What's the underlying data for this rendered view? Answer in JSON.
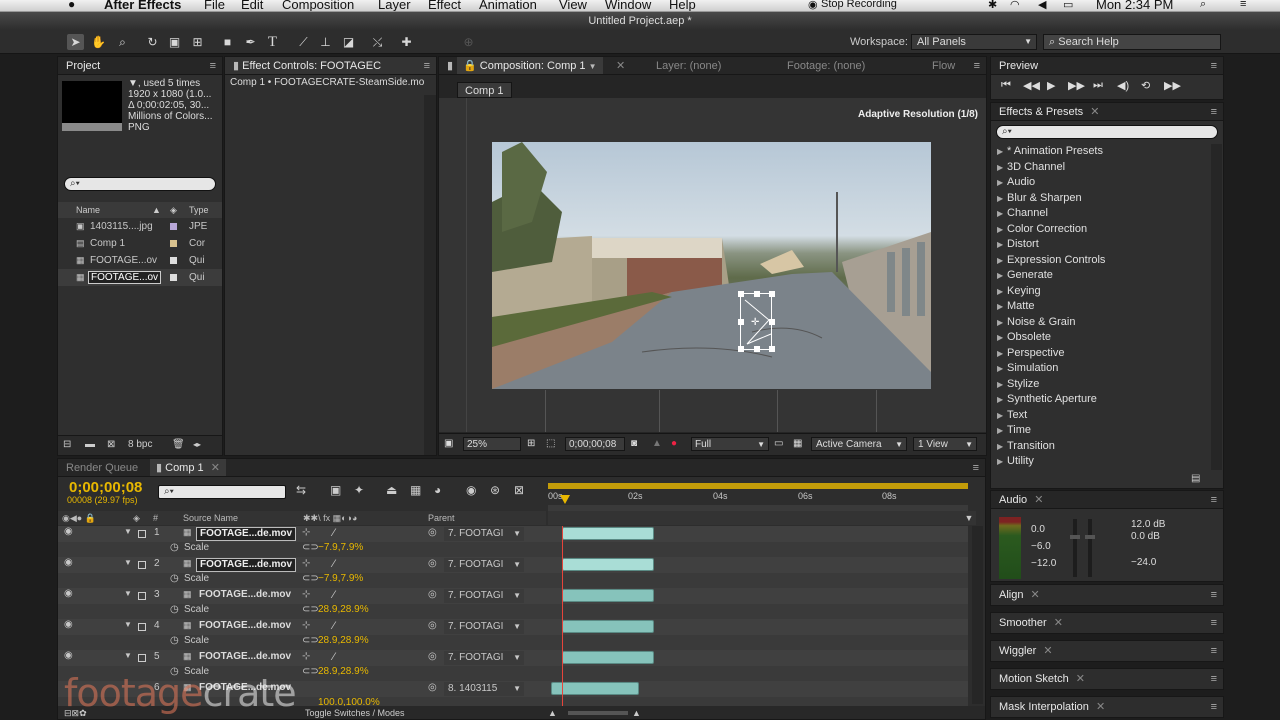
{
  "menubar": {
    "apple": "",
    "app": "After Effects",
    "items": [
      "File",
      "Edit",
      "Composition",
      "Layer",
      "Effect",
      "Animation",
      "View",
      "Window",
      "Help"
    ],
    "stop_recording": "Stop Recording",
    "clock": "Mon 2:34 PM"
  },
  "window_title": "Untitled Project.aep *",
  "toolbar": {
    "workspace_label": "Workspace:",
    "workspace_value": "All Panels",
    "search_help": "Search Help"
  },
  "project": {
    "tab": "Project",
    "info": [
      "▼, used 5 times",
      "1920 x 1080 (1.0...",
      "Δ 0;00:02:05, 30...",
      "Millions of Colors...",
      "PNG"
    ],
    "col_name": "Name",
    "col_type": "Type",
    "items": [
      {
        "name": "1403115....jpg",
        "type": "JPE"
      },
      {
        "name": "Comp 1",
        "type": "Cor"
      },
      {
        "name": "FOOTAGE...ov",
        "type": "Qui"
      },
      {
        "name": "FOOTAGE...ov",
        "type": "Qui"
      }
    ],
    "bpc": "8 bpc"
  },
  "effect_controls": {
    "tab": "Effect Controls: FOOTAGEC",
    "line": "Comp 1 • FOOTAGECRATE-SteamSide.mo"
  },
  "composition": {
    "tab": "Composition: Comp 1",
    "layer_tab": "Layer: (none)",
    "footage_tab": "Footage: (none)",
    "flow": "Flow",
    "comp_button": "Comp 1",
    "adaptive": "Adaptive Resolution (1/8)",
    "zoom": "25%",
    "timecode": "0;00;00;08",
    "quality": "Full",
    "camera": "Active Camera",
    "views": "1 View"
  },
  "preview": {
    "tab": "Preview"
  },
  "effects_presets": {
    "tab": "Effects & Presets",
    "items": [
      "* Animation Presets",
      "3D Channel",
      "Audio",
      "Blur & Sharpen",
      "Channel",
      "Color Correction",
      "Distort",
      "Expression Controls",
      "Generate",
      "Keying",
      "Matte",
      "Noise & Grain",
      "Obsolete",
      "Perspective",
      "Simulation",
      "Stylize",
      "Synthetic Aperture",
      "Text",
      "Time",
      "Transition",
      "Utility"
    ]
  },
  "audio": {
    "tab": "Audio",
    "left_levels": [
      "0.0",
      "−6.0",
      "−12.0"
    ],
    "right_levels": [
      "12.0 dB",
      "0.0 dB",
      "−24.0"
    ]
  },
  "side_panels": [
    "Align",
    "Smoother",
    "Wiggler",
    "Motion Sketch",
    "Mask Interpolation"
  ],
  "timeline": {
    "render_queue": "Render Queue",
    "comp_tab": "Comp 1",
    "timecode": "0;00;00;08",
    "frames": "00008 (29.97 fps)",
    "col_source": "Source Name",
    "col_parent": "Parent",
    "ruler": [
      "00s",
      "02s",
      "04s",
      "06s",
      "08s"
    ],
    "toggle": "Toggle Switches / Modes",
    "layers": [
      {
        "num": "1",
        "name": "FOOTAGE...de.mov",
        "prop": "Scale",
        "value": "−7.9,7.9%",
        "parent": "7. FOOTAGI",
        "boxed": true,
        "bar_color": "#a9ddd6"
      },
      {
        "num": "2",
        "name": "FOOTAGE...de.mov",
        "prop": "Scale",
        "value": "−7.9,7.9%",
        "parent": "7. FOOTAGI",
        "boxed": true,
        "bar_color": "#a9ddd6"
      },
      {
        "num": "3",
        "name": "FOOTAGE...de.mov",
        "prop": "Scale",
        "value": "28.9,28.9%",
        "parent": "7. FOOTAGI",
        "boxed": false,
        "bar_color": "#86c3bb"
      },
      {
        "num": "4",
        "name": "FOOTAGE...de.mov",
        "prop": "Scale",
        "value": "28.9,28.9%",
        "parent": "7. FOOTAGI",
        "boxed": false,
        "bar_color": "#86c3bb"
      },
      {
        "num": "5",
        "name": "FOOTAGE...de.mov",
        "prop": "Scale",
        "value": "28.9,28.9%",
        "parent": "7. FOOTAGI",
        "boxed": false,
        "bar_color": "#86c3bb"
      },
      {
        "num": "6",
        "name": "FOOTAGE...de.mov",
        "prop": "",
        "value": "100.0,100.0%",
        "parent": "8. 1403115",
        "boxed": false,
        "bar_color": "#86c3bb"
      }
    ]
  },
  "watermark": {
    "part1": "footage",
    "part2": "crate"
  },
  "colors": {
    "accent_yellow": "#e8b800",
    "layer_bar": "#86c3bb",
    "playhead": "#e5443b"
  }
}
